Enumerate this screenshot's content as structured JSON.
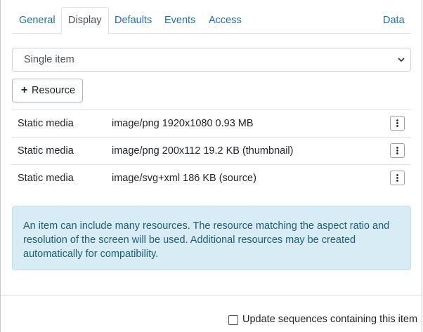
{
  "tabs": [
    {
      "label": "General"
    },
    {
      "label": "Display",
      "active": true
    },
    {
      "label": "Defaults"
    },
    {
      "label": "Events"
    },
    {
      "label": "Access"
    },
    {
      "label": "Data"
    }
  ],
  "display_mode": {
    "selected": "Single item"
  },
  "resource_button": {
    "label": "Resource",
    "icon": "plus-icon"
  },
  "resources": [
    {
      "type": "Static media",
      "description": "image/png 1920x1080 0.93 MB"
    },
    {
      "type": "Static media",
      "description": "image/png 200x112 19.2 KB (thumbnail)"
    },
    {
      "type": "Static media",
      "description": "image/svg+xml 186 KB (source)"
    }
  ],
  "info_alert": {
    "text": "An item can include many resources. The resource matching the aspect ratio and resolution of the screen will be used. Additional resources may be created automatically for compatibility."
  },
  "update_sequences": {
    "label": "Update sequences containing this item",
    "checked": false
  },
  "colors": {
    "link": "#1e6fb4",
    "alert_bg": "#d7ecf5",
    "alert_text": "#1d5d78"
  }
}
